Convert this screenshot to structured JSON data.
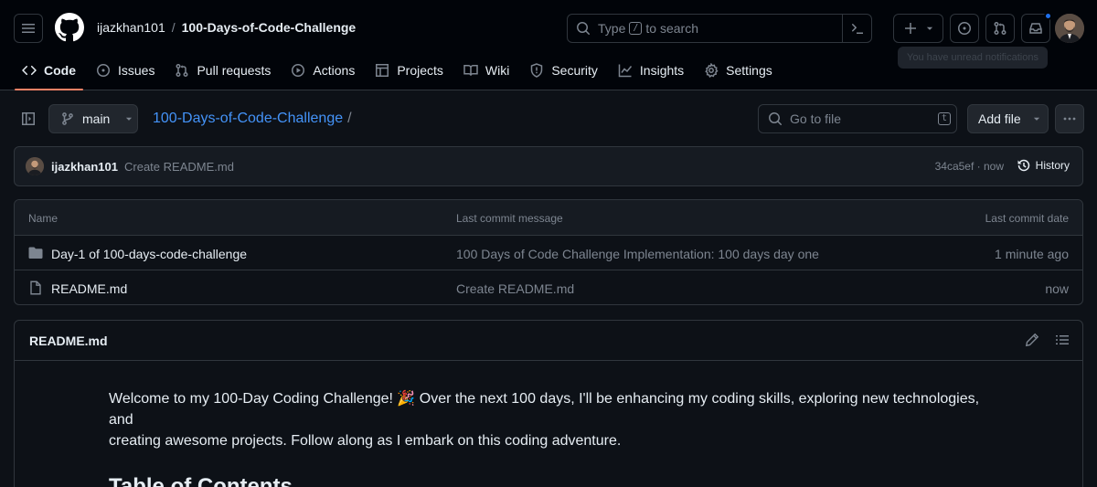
{
  "header": {
    "owner": "ijazkhan101",
    "separator": "/",
    "repo": "100-Days-of-Code-Challenge",
    "search_prefix": "Type",
    "search_key": "/",
    "search_suffix": "to search",
    "tooltip": "You have unread notifications"
  },
  "nav": {
    "items": [
      {
        "label": "Code",
        "icon": "code-icon"
      },
      {
        "label": "Issues",
        "icon": "issue-icon"
      },
      {
        "label": "Pull requests",
        "icon": "pull-request-icon"
      },
      {
        "label": "Actions",
        "icon": "play-icon"
      },
      {
        "label": "Projects",
        "icon": "table-icon"
      },
      {
        "label": "Wiki",
        "icon": "book-icon"
      },
      {
        "label": "Security",
        "icon": "shield-icon"
      },
      {
        "label": "Insights",
        "icon": "graph-icon"
      },
      {
        "label": "Settings",
        "icon": "gear-icon"
      }
    ]
  },
  "toolbar": {
    "branch": "main",
    "path_repo": "100-Days-of-Code-Challenge",
    "path_sep": "/",
    "goto_placeholder": "Go to file",
    "goto_key": "t",
    "add_file": "Add file"
  },
  "commit": {
    "author": "ijazkhan101",
    "message": "Create README.md",
    "sha_time": "34ca5ef · now",
    "history": "History"
  },
  "files": {
    "headers": {
      "name": "Name",
      "message": "Last commit message",
      "date": "Last commit date"
    },
    "rows": [
      {
        "name": "Day-1 of 100-days-code-challenge",
        "type": "folder",
        "message": "100 Days of Code Challenge Implementation: 100 days day one",
        "date": "1 minute ago"
      },
      {
        "name": "README.md",
        "type": "file",
        "message": "Create README.md",
        "date": "now"
      }
    ]
  },
  "readme": {
    "title": "README.md",
    "intro_1": "Welcome to my 100-Day Coding Challenge! 🎉  Over the next 100 days, I'll be enhancing my coding skills, exploring new technologies, and",
    "intro_2": "creating awesome projects. Follow along as I embark on this coding adventure.",
    "heading": "Table of Contents"
  },
  "colors": {
    "accent_link": "#4493f8",
    "active_tab_underline": "#f78166",
    "notification_dot": "#1f6feb"
  }
}
